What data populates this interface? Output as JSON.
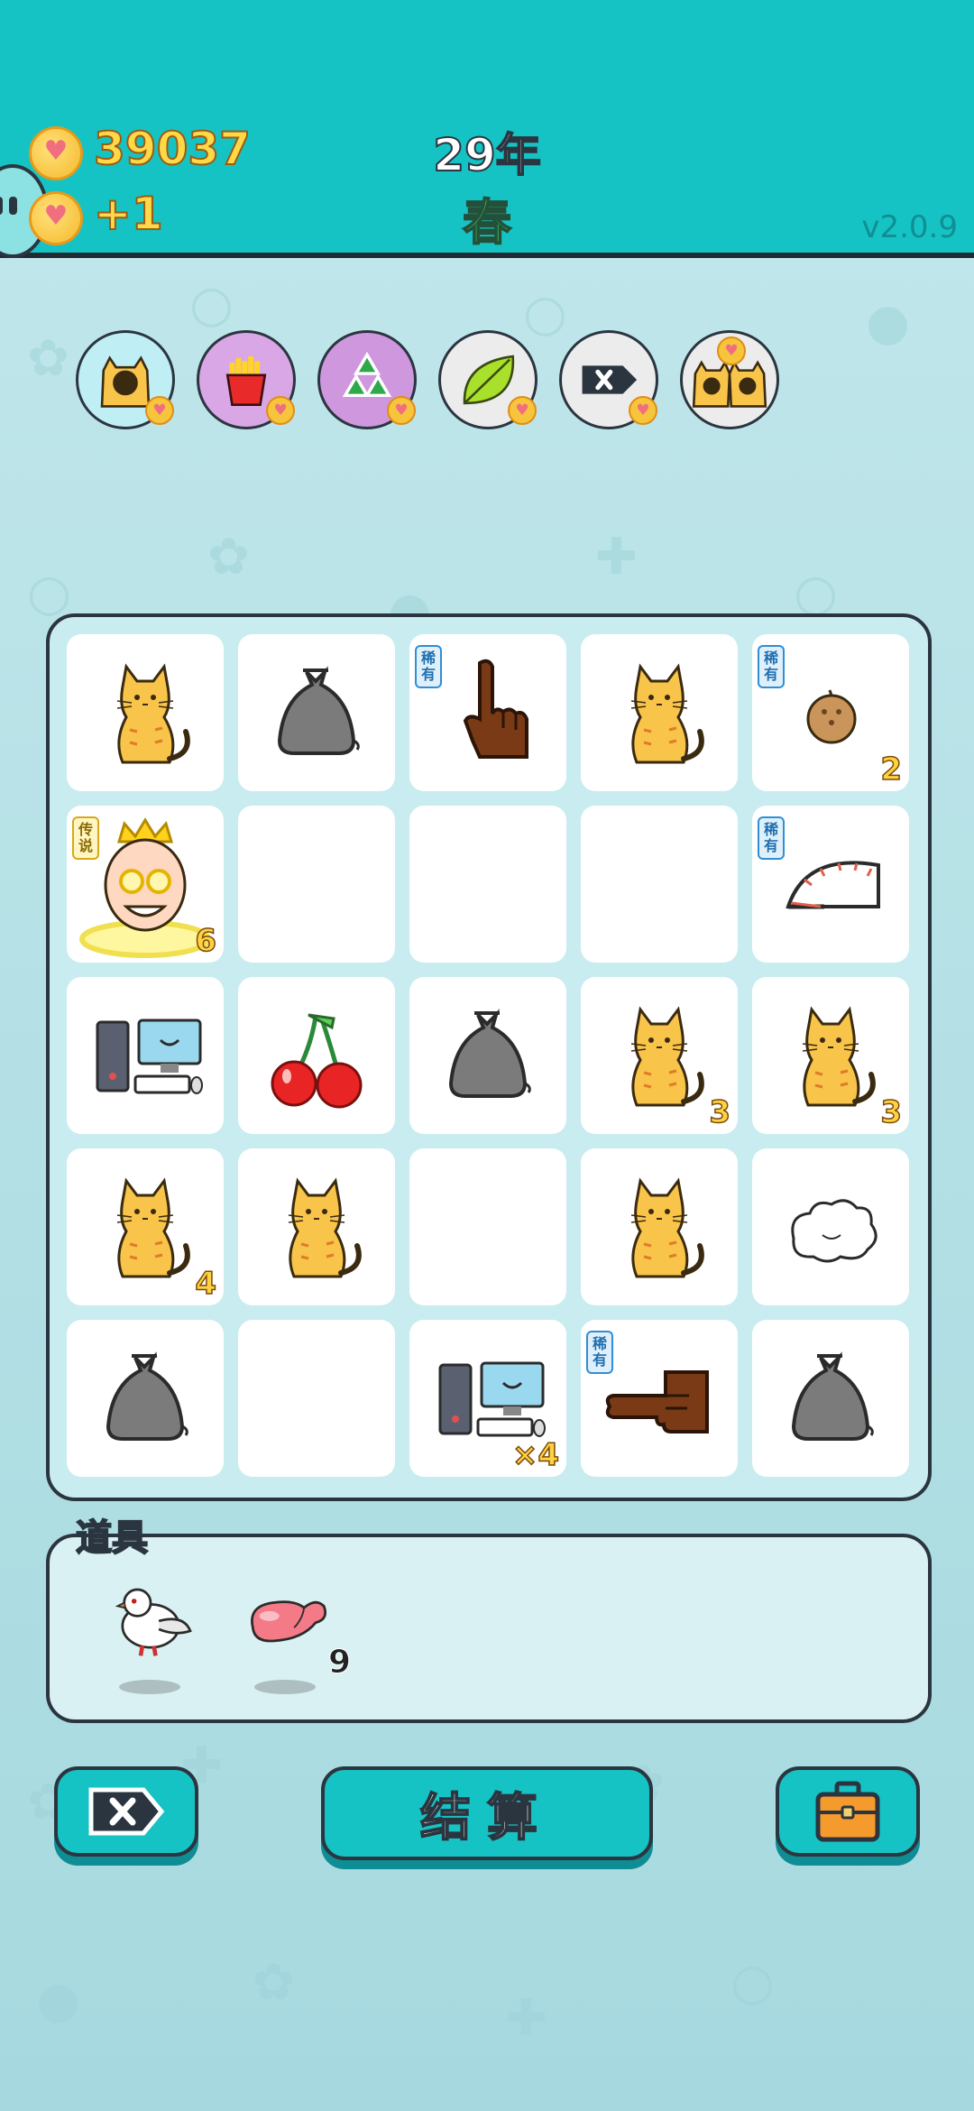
{
  "header": {
    "coins": "39037",
    "income": "+1",
    "year": "29年",
    "season": "春",
    "version": "v2.0.9"
  },
  "relics": [
    {
      "icon": "cat-relic-icon",
      "color": "#bfeef5"
    },
    {
      "icon": "fries-relic-icon",
      "color": "#d9a6e6"
    },
    {
      "icon": "recycle-relic-icon",
      "color": "#cf97dd"
    },
    {
      "icon": "leaf-relic-icon",
      "color": "#ececec"
    },
    {
      "icon": "remove-relic-icon",
      "color": "#ececec"
    },
    {
      "icon": "cat-pair-relic-icon",
      "color": "#ececec"
    }
  ],
  "grid": [
    [
      {
        "icon": "cat-icon",
        "badge": "",
        "count": ""
      },
      {
        "icon": "trash-bag-icon",
        "badge": "",
        "count": ""
      },
      {
        "icon": "pointing-finger-up-icon",
        "badge": "稀有",
        "count": ""
      },
      {
        "icon": "cat-icon",
        "badge": "",
        "count": ""
      },
      {
        "icon": "coconut-icon",
        "badge": "稀有",
        "count": "2"
      }
    ],
    [
      {
        "icon": "king-icon",
        "badge": "传说",
        "count": "6"
      },
      {
        "icon": "",
        "badge": "",
        "count": ""
      },
      {
        "icon": "",
        "badge": "",
        "count": ""
      },
      {
        "icon": "",
        "badge": "",
        "count": ""
      },
      {
        "icon": "speedometer-icon",
        "badge": "稀有",
        "count": ""
      }
    ],
    [
      {
        "icon": "computer-icon",
        "badge": "",
        "count": ""
      },
      {
        "icon": "cherry-icon",
        "badge": "",
        "count": ""
      },
      {
        "icon": "trash-bag-icon",
        "badge": "",
        "count": ""
      },
      {
        "icon": "cat-icon",
        "badge": "",
        "count": "3"
      },
      {
        "icon": "cat-icon",
        "badge": "",
        "count": "3"
      }
    ],
    [
      {
        "icon": "cat-icon",
        "badge": "",
        "count": "4"
      },
      {
        "icon": "cat-icon",
        "badge": "",
        "count": ""
      },
      {
        "icon": "",
        "badge": "",
        "count": ""
      },
      {
        "icon": "cat-icon",
        "badge": "",
        "count": ""
      },
      {
        "icon": "cloud-icon",
        "badge": "",
        "count": ""
      }
    ],
    [
      {
        "icon": "trash-bag-icon",
        "badge": "",
        "count": ""
      },
      {
        "icon": "",
        "badge": "",
        "count": ""
      },
      {
        "icon": "computer-icon",
        "badge": "",
        "count": "×4"
      },
      {
        "icon": "pointing-finger-side-icon",
        "badge": "稀有",
        "count": ""
      },
      {
        "icon": "trash-bag-icon",
        "badge": "",
        "count": ""
      }
    ]
  ],
  "items": {
    "title": "道具",
    "list": [
      {
        "icon": "dove-icon",
        "count": ""
      },
      {
        "icon": "liver-icon",
        "count": "9"
      }
    ]
  },
  "buttons": {
    "remove_icon": "remove-tag-icon",
    "settle_label": "结算",
    "bag_icon": "briefcase-icon"
  }
}
